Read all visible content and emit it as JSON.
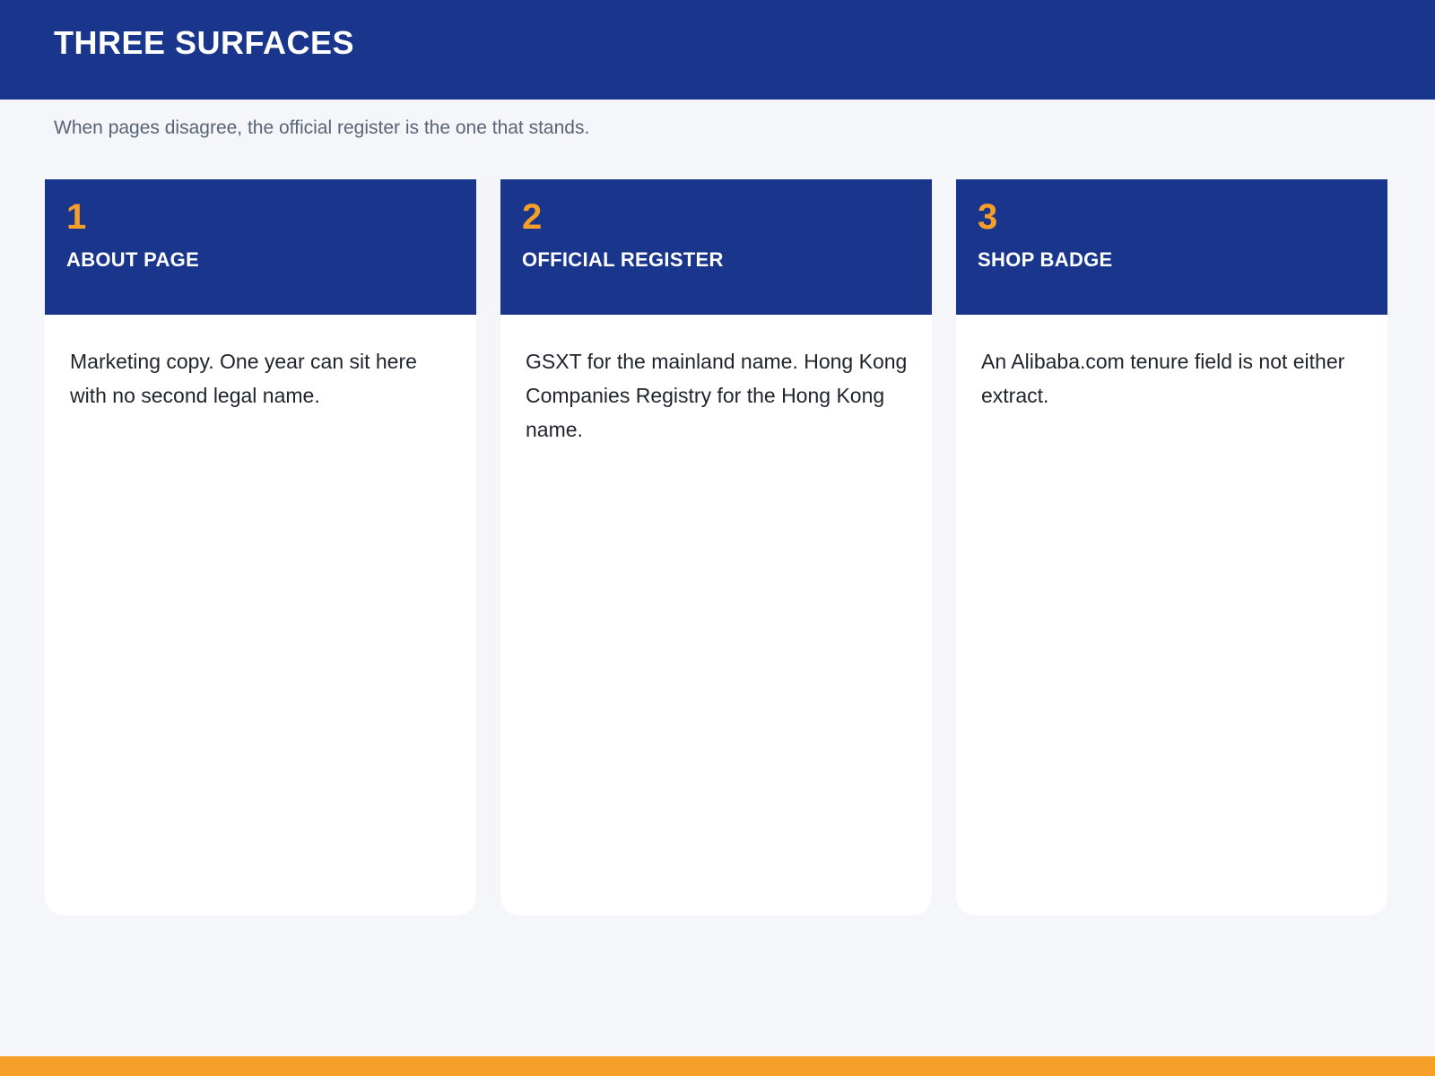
{
  "header": {
    "title": "THREE SURFACES"
  },
  "subtitle": "When pages disagree, the official register is the one that stands.",
  "cards": [
    {
      "number": "1",
      "title": "ABOUT PAGE",
      "body": "Marketing copy. One year can sit here with no second legal name."
    },
    {
      "number": "2",
      "title": "OFFICIAL REGISTER",
      "body": "GSXT for the mainland name. Hong Kong Companies Registry for the Hong Kong name."
    },
    {
      "number": "3",
      "title": "SHOP BADGE",
      "body": "An Alibaba.com tenure field is not either extract."
    }
  ],
  "colors": {
    "primary": "#19368c",
    "accent": "#f59f28",
    "background": "#f4f6fa"
  }
}
